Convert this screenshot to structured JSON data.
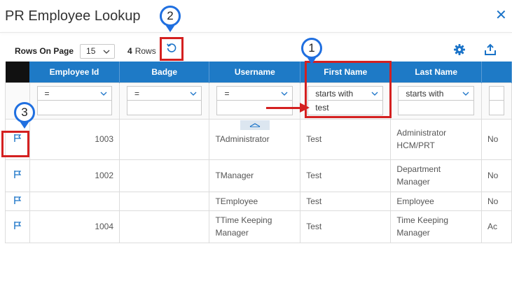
{
  "dialog": {
    "title": "PR Employee Lookup",
    "close_icon": "close-icon"
  },
  "toolbar": {
    "rows_on_page_label": "Rows On Page",
    "rows_on_page_value": "15",
    "row_count": "4",
    "row_count_label": "Rows"
  },
  "callouts": {
    "c1": "1",
    "c2": "2",
    "c3": "3"
  },
  "columns": [
    "Employee Id",
    "Badge",
    "Username",
    "First Name",
    "Last Name"
  ],
  "filters": {
    "employee_id_op": "=",
    "badge_op": "=",
    "username_op": "=",
    "first_name_op": "starts with",
    "first_name_value": "test",
    "last_name_op": "starts with"
  },
  "rows": [
    {
      "id": "1003",
      "badge": "",
      "username": "TAdministrator",
      "first": "Test",
      "last_l1": "Administrator",
      "last_l2": "HCM/PRT",
      "extra": "No"
    },
    {
      "id": "1002",
      "badge": "",
      "username": "TManager",
      "first": "Test",
      "last_l1": "Department",
      "last_l2": "Manager",
      "extra": "No"
    },
    {
      "id": "",
      "badge": "",
      "username": "TEmployee",
      "first": "Test",
      "last_l1": "Employee",
      "last_l2": "",
      "extra": "No"
    },
    {
      "id": "1004",
      "badge": "",
      "username_l1": "TTime Keeping",
      "username_l2": "Manager",
      "first": "Test",
      "last_l1": "Time Keeping",
      "last_l2": "Manager",
      "extra": "Ac"
    }
  ],
  "colors": {
    "header_blue": "#1e7ac6",
    "annotation_red": "#d42020",
    "callout_blue": "#1f6fe0"
  }
}
